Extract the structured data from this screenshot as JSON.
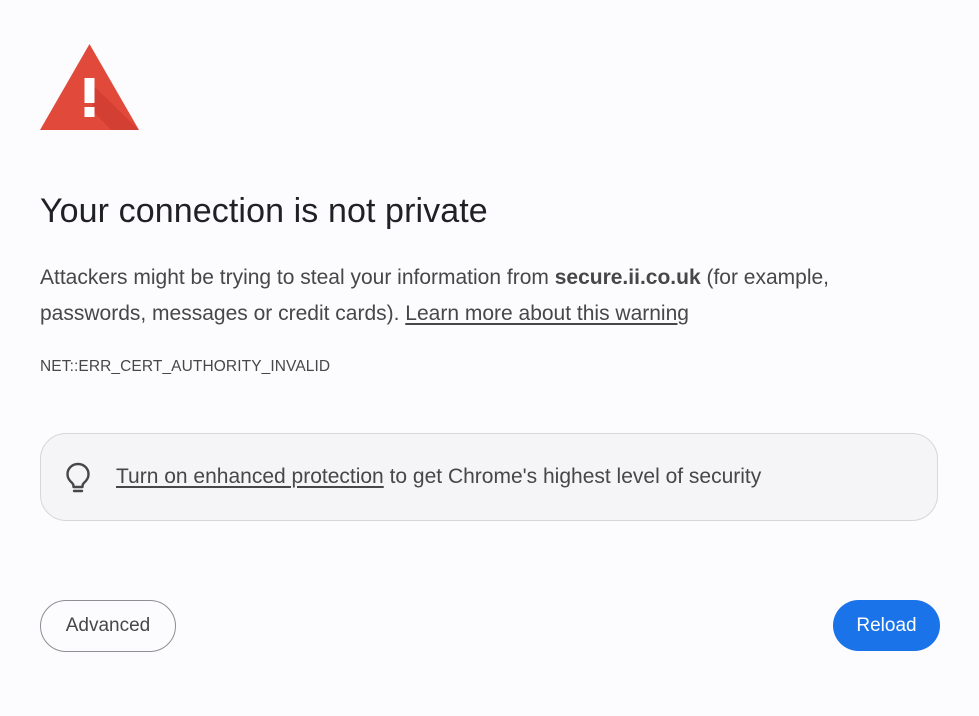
{
  "colors": {
    "background": "#fcfbfe",
    "warning_red": "#e14a3b",
    "primary_blue": "#1a73e8",
    "text": "#474747",
    "title": "#202124"
  },
  "icons": {
    "warning": "warning-triangle-icon",
    "protection": "lightbulb-icon"
  },
  "title": "Your connection is not private",
  "message": {
    "before_domain": "Attackers might be trying to steal your information from ",
    "domain": "secure.ii.co.uk",
    "after_domain": " (for example, passwords, messages or credit cards). ",
    "learn_more_link": "Learn more about this warning"
  },
  "error_code": "NET::ERR_CERT_AUTHORITY_INVALID",
  "protection": {
    "link_text": "Turn on enhanced protection",
    "suffix": " to get Chrome's highest level of security"
  },
  "buttons": {
    "advanced": "Advanced",
    "reload": "Reload"
  }
}
